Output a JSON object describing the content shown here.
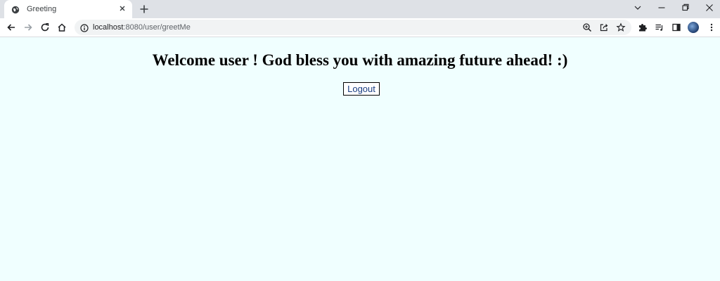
{
  "browser": {
    "tab": {
      "title": "Greeting",
      "favicon_icon": "globe-icon",
      "close_icon": "close-icon"
    },
    "new_tab_icon": "plus-icon",
    "window_controls": {
      "tab_search_icon": "chevron-down-icon",
      "minimize_icon": "minimize-icon",
      "restore_icon": "restore-icon",
      "close_icon": "close-icon"
    },
    "toolbar": {
      "back_icon": "arrow-left-icon",
      "forward_icon": "arrow-right-icon",
      "reload_icon": "reload-icon",
      "home_icon": "home-icon",
      "url_host": "localhost",
      "url_rest": ":8080/user/greetMe",
      "site_info_icon": "info-icon",
      "zoom_icon": "zoom-icon",
      "share_icon": "share-icon",
      "bookmark_icon": "star-icon",
      "extensions_icon": "puzzle-icon",
      "media_icon": "media-queue-icon",
      "side_panel_icon": "side-panel-icon",
      "menu_icon": "kebab-menu-icon"
    }
  },
  "page": {
    "heading": "Welcome user ! God bless you with amazing future ahead! :)",
    "logout_label": "Logout",
    "background_color": "#f0ffff"
  }
}
